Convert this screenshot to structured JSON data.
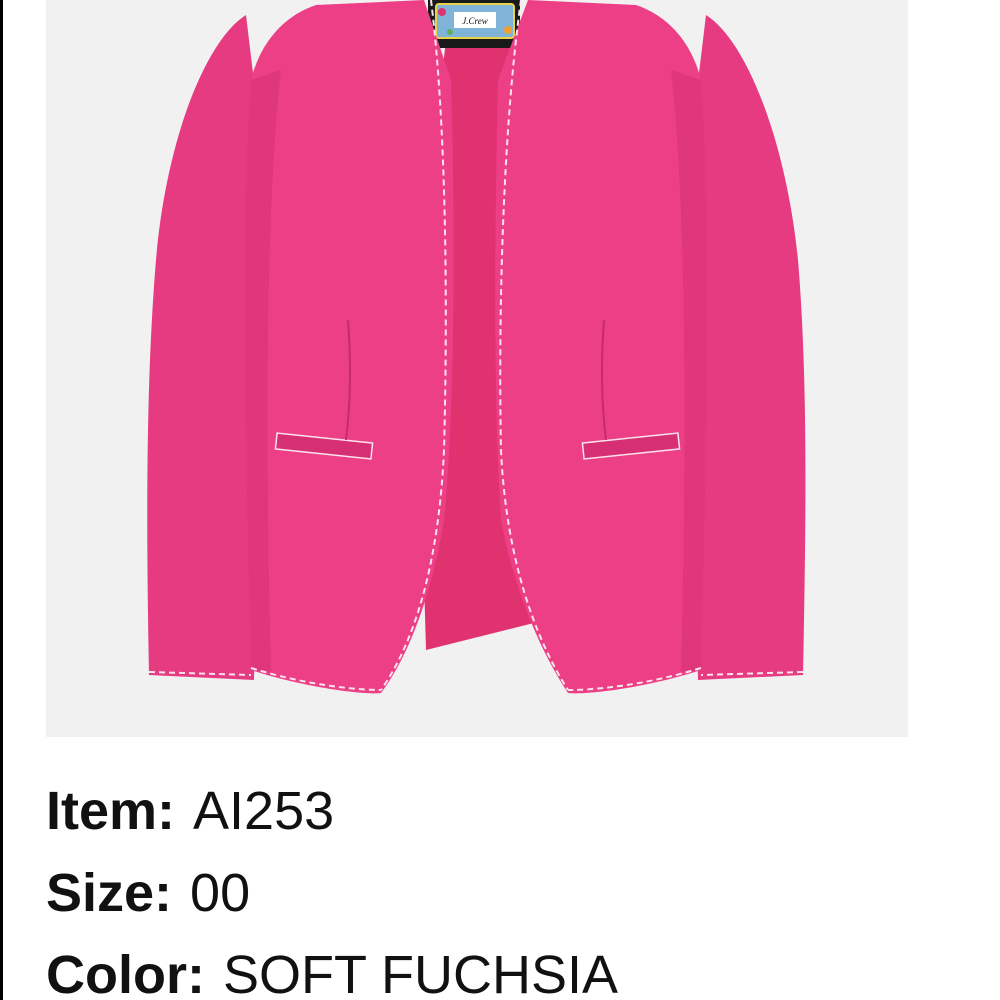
{
  "product_image": {
    "brand_label_text": "J.Crew",
    "garment": "jacket-icon",
    "colors": {
      "background": "#f1f1f1",
      "garment": "#ec3f86",
      "garment_shadow": "#d72f73",
      "lining": "#e0326f",
      "stitching": "#fbe3ee"
    }
  },
  "details": {
    "item_label": "Item:",
    "item_value": "AI253",
    "size_label": "Size:",
    "size_value": "00",
    "color_label": "Color:",
    "color_value": "SOFT FUCHSIA"
  }
}
